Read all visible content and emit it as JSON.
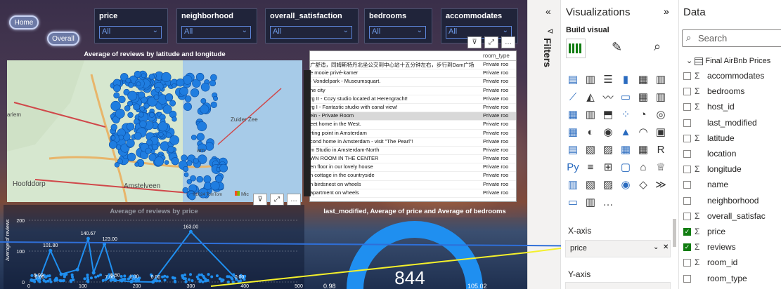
{
  "nav": {
    "home": "Home",
    "overall": "Overall"
  },
  "slicers": [
    {
      "title": "price",
      "value": "All"
    },
    {
      "title": "neighborhood",
      "value": "All"
    },
    {
      "title": "overall_satisfaction",
      "value": "All"
    },
    {
      "title": "bedrooms",
      "value": "All"
    },
    {
      "title": "accommodates",
      "value": "All"
    }
  ],
  "map": {
    "title": "Average of reviews by latitude and longitude",
    "labels": [
      "Zuider Zee",
      "Hoofddorp",
      "Amstelveen",
      "arlem",
      "am",
      "Hoofddorp"
    ],
    "attribution": "©2024 TomTom",
    "brand": "Mic"
  },
  "table": {
    "column": "room_type",
    "rows": [
      {
        "name": "广舒适，同姆斯特丹北坐公交到中心站十五分钟左右，步行到Dam广场",
        "type": "Private roo"
      },
      {
        "name": "e mooie privé-kamer",
        "type": "Private roo"
      },
      {
        "name": "- Vondelpark - Museumsquart.",
        "type": "Private roo"
      },
      {
        "name": "he city",
        "type": "Private roo"
      },
      {
        "name": "rg II - Cozy studio located at Herengracht!",
        "type": "Private roo"
      },
      {
        "name": "rg I - Fantastic studio with canal view!",
        "type": "Private roo"
      },
      {
        "name": "ein - Private Room",
        "type": "Private roo"
      },
      {
        "name": "eet home in the West.",
        "type": "Private roo"
      },
      {
        "name": "rting point in Amsterdam",
        "type": "Private roo"
      },
      {
        "name": "cond home in Amsterdam - visit \"The Pearl\"!",
        "type": "Private roo"
      },
      {
        "name": "m Studio in Amsterdam-North",
        "type": "Private roo"
      },
      {
        "name": "WN ROOM IN THE CENTER",
        "type": "Private roo"
      },
      {
        "name": "en floor in our lovely house",
        "type": "Private roo"
      },
      {
        "name": "n cottage in the countryside",
        "type": "Private roo"
      },
      {
        "name": "n birdsnest on wheels",
        "type": "Private roo"
      },
      {
        "name": "apartment on wheels",
        "type": "Private roo"
      }
    ]
  },
  "line": {
    "title": "Average of reviews by price",
    "ylabel": "Average of reviews",
    "yticks": [
      "200",
      "100",
      "0"
    ],
    "xticks": [
      "0",
      "100",
      "200",
      "300",
      "400",
      "500"
    ],
    "annotations": [
      "140.67",
      "123.00",
      "101.80",
      "163.00",
      "6.00",
      "0.00",
      "5.50",
      "1.00",
      "0.00",
      "0.00",
      "7.00"
    ]
  },
  "gauge": {
    "title": "last_modified, Average of price and Average of bedrooms",
    "value": "844",
    "min": "0.98",
    "max": "105.02"
  },
  "chart_data": {
    "type": "line",
    "title": "Average of reviews by price",
    "xlabel": "",
    "ylabel": "Average of reviews",
    "xlim": [
      0,
      500
    ],
    "ylim": [
      0,
      200
    ],
    "x": [
      5,
      20,
      40,
      60,
      90,
      110,
      120,
      140,
      160,
      190,
      230,
      300,
      390
    ],
    "values": [
      6,
      10,
      101.8,
      25,
      40,
      140.67,
      30,
      123,
      5.5,
      1,
      0,
      163,
      0
    ]
  },
  "filters": {
    "label": "Filters"
  },
  "viz": {
    "title": "Visualizations",
    "build": "Build visual",
    "xaxis": "X-axis",
    "xfield": "price",
    "yaxis": "Y-axis"
  },
  "data": {
    "title": "Data",
    "search_placeholder": "Search",
    "table": "Final AirBnb Prices",
    "fields": [
      {
        "name": "accommodates",
        "sigma": true,
        "checked": false
      },
      {
        "name": "bedrooms",
        "sigma": true,
        "checked": false
      },
      {
        "name": "host_id",
        "sigma": true,
        "checked": false
      },
      {
        "name": "last_modified",
        "sigma": false,
        "checked": false
      },
      {
        "name": "latitude",
        "sigma": true,
        "checked": false
      },
      {
        "name": "location",
        "sigma": false,
        "checked": false
      },
      {
        "name": "longitude",
        "sigma": true,
        "checked": false
      },
      {
        "name": "name",
        "sigma": false,
        "checked": false
      },
      {
        "name": "neighborhood",
        "sigma": false,
        "checked": false
      },
      {
        "name": "overall_satisfac",
        "sigma": true,
        "checked": false
      },
      {
        "name": "price",
        "sigma": true,
        "checked": true
      },
      {
        "name": "reviews",
        "sigma": true,
        "checked": true
      },
      {
        "name": "room_id",
        "sigma": true,
        "checked": false
      },
      {
        "name": "room_type",
        "sigma": false,
        "checked": false
      }
    ]
  }
}
